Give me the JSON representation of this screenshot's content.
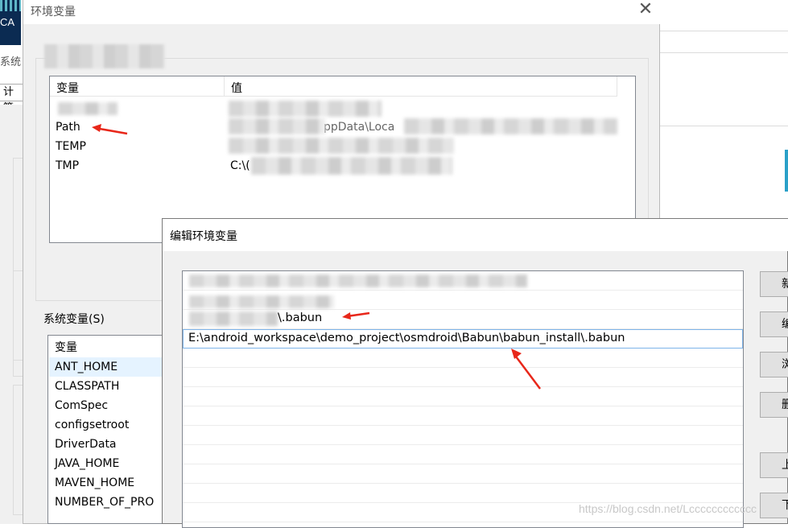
{
  "background": {
    "app_icon_text": "CA",
    "system_label": "系统",
    "tab_label": "计算"
  },
  "env_window": {
    "title": "环境变量",
    "close_glyph": "✕",
    "user_list": {
      "col_variable": "变量",
      "col_value": "值",
      "rows": [
        {
          "name": "",
          "value": ""
        },
        {
          "name": "Path",
          "value": "ppData\\Loca"
        },
        {
          "name": "TEMP",
          "value": ""
        },
        {
          "name": "TMP",
          "value": "C:\\("
        }
      ]
    },
    "system_label": "系统变量(S)",
    "system_list": {
      "col_variable": "变量",
      "rows": [
        "ANT_HOME",
        "CLASSPATH",
        "ComSpec",
        "configsetroot",
        "DriverData",
        "JAVA_HOME",
        "MAVEN_HOME",
        "NUMBER_OF_PRO"
      ]
    }
  },
  "edit_dialog": {
    "title": "编辑环境变量",
    "entries": [
      "",
      "",
      "\\.babun",
      "E:\\android_workspace\\demo_project\\osmdroid\\Babun\\babun_install\\.babun"
    ],
    "buttons": [
      "新",
      "编",
      "浏",
      "删",
      "上",
      "下"
    ]
  },
  "watermark": "https://blog.csdn.net/Lcccccccccccc",
  "colors": {
    "dialog_bg": "#f0f0f0",
    "selection": "#e5f3ff",
    "arrow": "#e8271a"
  }
}
